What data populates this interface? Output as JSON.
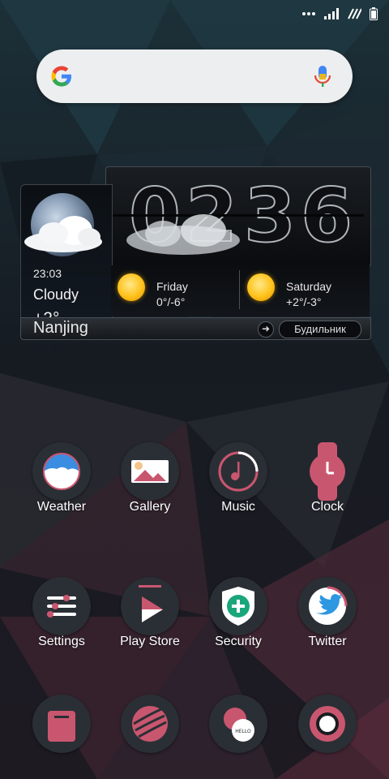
{
  "status_bar": {
    "icons": [
      "more-dots-icon",
      "signal-icon",
      "wifi-icon",
      "battery-icon"
    ]
  },
  "search": {
    "brand": "google-g-logo",
    "voice_icon": "microphone-icon"
  },
  "weather_widget": {
    "time": "23:03",
    "condition": "Cloudy",
    "temperature": "+2°",
    "clock_hours": "02",
    "clock_minutes": "36",
    "forecast": [
      {
        "day": "Friday",
        "temp": "0°/-6°",
        "icon": "sun-icon"
      },
      {
        "day": "Saturday",
        "temp": "+2°/-3°",
        "icon": "sun-icon"
      }
    ],
    "city": "Nanjing",
    "alarm_label": "Будильник"
  },
  "apps": {
    "row1": [
      {
        "label": "Weather",
        "icon": "weather-icon"
      },
      {
        "label": "Gallery",
        "icon": "gallery-icon"
      },
      {
        "label": "Music",
        "icon": "music-icon"
      },
      {
        "label": "Clock",
        "icon": "clock-icon"
      }
    ],
    "row2": [
      {
        "label": "Settings",
        "icon": "settings-icon"
      },
      {
        "label": "Play Store",
        "icon": "play-store-icon"
      },
      {
        "label": "Security",
        "icon": "security-icon"
      },
      {
        "label": "Twitter",
        "icon": "twitter-icon"
      }
    ],
    "dock": [
      {
        "icon": "phone-icon"
      },
      {
        "icon": "browser-globe-icon"
      },
      {
        "icon": "messaging-hello-icon"
      },
      {
        "icon": "camera-icon"
      }
    ]
  },
  "colors": {
    "accent_pink": "#c9566f",
    "icon_bg": "#2a2f35",
    "search_bg": "#eceef0"
  }
}
